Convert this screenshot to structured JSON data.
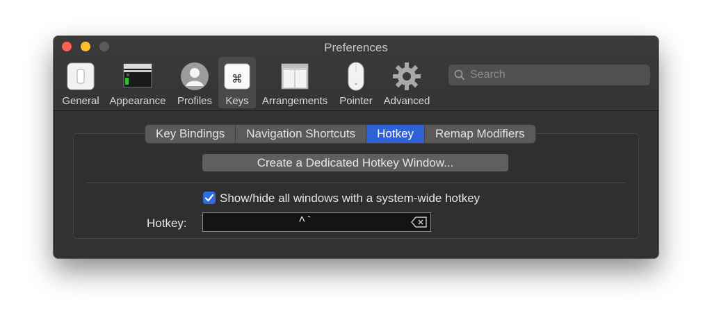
{
  "window": {
    "title": "Preferences"
  },
  "toolbar": {
    "items": [
      {
        "label": "General",
        "icon": "general-switch-icon"
      },
      {
        "label": "Appearance",
        "icon": "appearance-window-icon"
      },
      {
        "label": "Profiles",
        "icon": "profile-person-icon"
      },
      {
        "label": "Keys",
        "icon": "command-key-icon",
        "selected": true
      },
      {
        "label": "Arrangements",
        "icon": "arrangements-windows-icon"
      },
      {
        "label": "Pointer",
        "icon": "mouse-icon"
      },
      {
        "label": "Advanced",
        "icon": "gear-icon"
      }
    ]
  },
  "search": {
    "placeholder": "Search"
  },
  "tabs": [
    {
      "label": "Key Bindings"
    },
    {
      "label": "Navigation Shortcuts"
    },
    {
      "label": "Hotkey",
      "active": true
    },
    {
      "label": "Remap Modifiers"
    }
  ],
  "hotkey_panel": {
    "dedicated_button": "Create a Dedicated Hotkey Window...",
    "checkbox_label": "Show/hide all windows with a system-wide hotkey",
    "checkbox_checked": true,
    "hotkey_label": "Hotkey:",
    "hotkey_value": "^`"
  },
  "colors": {
    "accent": "#2f62d7",
    "window_bg": "#323232"
  }
}
